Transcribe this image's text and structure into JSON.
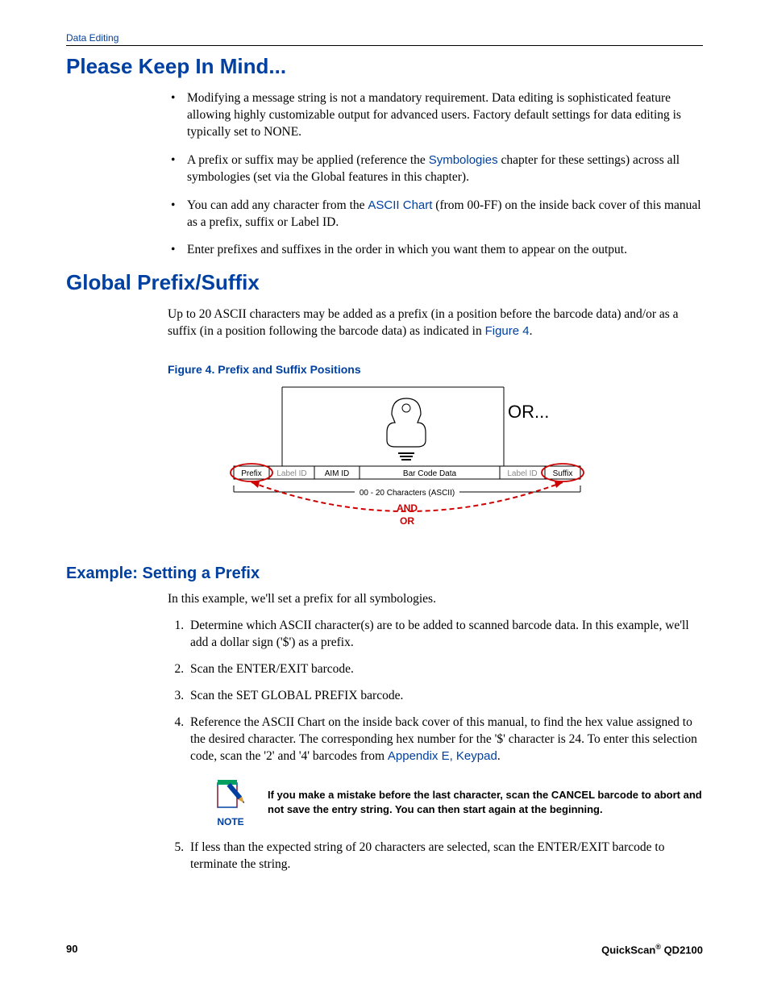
{
  "header": {
    "section": "Data Editing"
  },
  "heading1": "Please Keep In Mind...",
  "bullets": [
    {
      "text": "Modifying a message string is not a mandatory requirement.  Data editing is sophisticated feature allowing highly customizable output for advanced users. Factory default settings for data editing is typically set to NONE."
    },
    {
      "pre": "A prefix or suffix may be applied (reference the ",
      "link": "Symbologies",
      "post": " chapter for these settings) across all symbologies (set via the Global features in this chapter)."
    },
    {
      "pre": "You can add any character from the ",
      "link": "ASCII Chart",
      "post": " (from 00-FF) on the inside back cover of this manual as a prefix, suffix or Label ID."
    },
    {
      "text": "Enter prefixes and suffixes in the order in which you want them to appear on the output."
    }
  ],
  "heading2": "Global Prefix/Suffix",
  "para2": {
    "pre": "Up to 20 ASCII characters may be added as a prefix (in a position before the barcode data) and/or as a suffix (in a position following the barcode data) as indicated in ",
    "link": "Figure 4",
    "post": "."
  },
  "figure": {
    "caption": "Figure 4. Prefix and Suffix Positions",
    "or_label": "OR...",
    "cells": [
      "Prefix",
      "Label ID",
      "AIM ID",
      "Bar Code Data",
      "Label ID",
      "Suffix"
    ],
    "ascii_note": "00 - 20 Characters (ASCII)",
    "and": "AND",
    "or": "OR"
  },
  "heading3": "Example: Setting a Prefix",
  "para3": "In this example, we'll set a prefix for all symbologies.",
  "steps": [
    {
      "text": "Determine which ASCII character(s) are to be added to scanned barcode data. In this example, we'll add a dollar sign ('$') as a prefix."
    },
    {
      "text": "Scan the ENTER/EXIT barcode."
    },
    {
      "text": "Scan the SET GLOBAL PREFIX barcode."
    },
    {
      "pre": "Reference the ASCII Chart on the inside back cover of this manual, to find the hex value assigned to the desired character. The corresponding hex number for the '$' character is 24. To enter this selection code, scan the '2' and '4' barcodes from ",
      "link": "Appendix E, Keypad",
      "post": "."
    },
    {
      "text": "If less than the expected string of 20 characters are selected, scan the ENTER/EXIT barcode to terminate the string."
    }
  ],
  "note": {
    "label": "NOTE",
    "text": "If you make a mistake before the last character, scan the CANCEL barcode to abort and not save the entry string. You can then start again at the beginning."
  },
  "footer": {
    "page": "90",
    "product_pre": "QuickScan",
    "product_post": " QD2100"
  }
}
